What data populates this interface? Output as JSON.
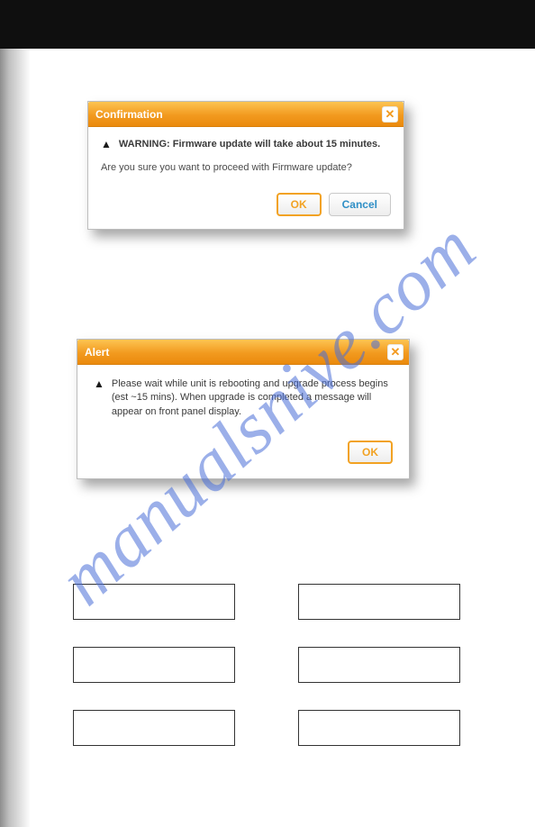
{
  "dialog1": {
    "title": "Confirmation",
    "close": "✕",
    "warning": "WARNING: Firmware update will take about 15 minutes.",
    "question": "Are you sure you want to proceed with Firmware update?",
    "ok": "OK",
    "cancel": "Cancel"
  },
  "dialog2": {
    "title": "Alert",
    "close": "✕",
    "message": "Please wait while unit is rebooting and upgrade process begins (est ~15 mins). When upgrade is completed a message will appear on front panel display.",
    "ok": "OK"
  },
  "watermark": "manualsnive.com",
  "icons": {
    "warn": "▲"
  }
}
